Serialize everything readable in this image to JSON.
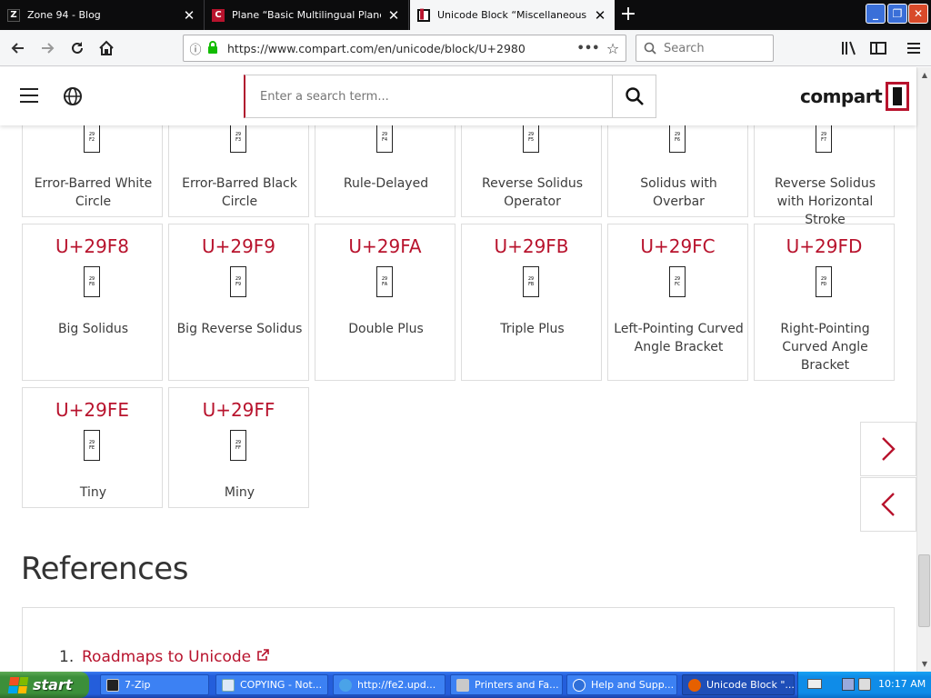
{
  "browser": {
    "tabs": [
      {
        "title": "Zone 94 - Blog",
        "favicon": "zone94-icon"
      },
      {
        "title": "Plane “Basic Multilingual Plane”",
        "favicon": "compart-icon"
      },
      {
        "title": "Unicode Block “Miscellaneous Math",
        "favicon": "compart-icon",
        "active": true
      }
    ],
    "close_glyph": "✕",
    "new_tab_glyph": "+",
    "window_controls": {
      "minimize": "_",
      "maximize": "❐",
      "close": "✕"
    },
    "url": "https://www.compart.com/en/unicode/block/U+2980",
    "url_menu_glyph": "•••",
    "search_placeholder": "Search"
  },
  "site": {
    "search_placeholder": "Enter a search term...",
    "logo_text": "compart",
    "brand_color": "#b8132d"
  },
  "characters": [
    {
      "code": "",
      "glyph": [
        "29",
        "F2"
      ],
      "name": "Error-Barred White Circle"
    },
    {
      "code": "",
      "glyph": [
        "29",
        "F3"
      ],
      "name": "Error-Barred Black Circle"
    },
    {
      "code": "",
      "glyph": [
        "29",
        "F4"
      ],
      "name": "Rule-Delayed"
    },
    {
      "code": "",
      "glyph": [
        "29",
        "F5"
      ],
      "name": "Reverse Solidus Operator"
    },
    {
      "code": "",
      "glyph": [
        "29",
        "F6"
      ],
      "name": "Solidus with Overbar"
    },
    {
      "code": "",
      "glyph": [
        "29",
        "F7"
      ],
      "name": "Reverse Solidus with Horizontal Stroke"
    },
    {
      "code": "U+29F8",
      "glyph": [
        "29",
        "F8"
      ],
      "name": "Big Solidus"
    },
    {
      "code": "U+29F9",
      "glyph": [
        "29",
        "F9"
      ],
      "name": "Big Reverse Solidus"
    },
    {
      "code": "U+29FA",
      "glyph": [
        "29",
        "FA"
      ],
      "name": "Double Plus"
    },
    {
      "code": "U+29FB",
      "glyph": [
        "29",
        "FB"
      ],
      "name": "Triple Plus"
    },
    {
      "code": "U+29FC",
      "glyph": [
        "29",
        "FC"
      ],
      "name": "Left-Pointing Curved Angle Bracket"
    },
    {
      "code": "U+29FD",
      "glyph": [
        "29",
        "FD"
      ],
      "name": "Right-Pointing Curved Angle Bracket"
    },
    {
      "code": "U+29FE",
      "glyph": [
        "29",
        "FE"
      ],
      "name": "Tiny"
    },
    {
      "code": "U+29FF",
      "glyph": [
        "29",
        "FF"
      ],
      "name": "Miny"
    }
  ],
  "references": {
    "title": "References",
    "items": [
      {
        "number": "1.",
        "label": "Roadmaps to Unicode"
      }
    ]
  },
  "taskbar": {
    "start_label": "start",
    "tasks": [
      {
        "label": "7-Zip",
        "icon": "7zip-icon"
      },
      {
        "label": "COPYING - Not...",
        "icon": "notepad-icon"
      },
      {
        "label": "http://fe2.upd...",
        "icon": "ie-icon"
      },
      {
        "label": "Printers and Fa...",
        "icon": "printers-icon"
      },
      {
        "label": "Help and Supp...",
        "icon": "help-icon"
      },
      {
        "label": "Unicode Block \"...",
        "icon": "firefox-icon",
        "active": true
      }
    ],
    "clock": "10:17 AM"
  }
}
